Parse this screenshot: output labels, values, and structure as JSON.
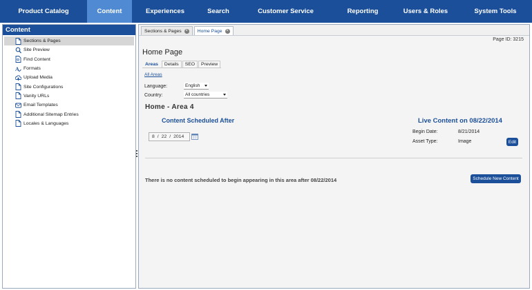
{
  "topnav": {
    "items": [
      {
        "label": "Product Catalog",
        "name": "nav-product-catalog"
      },
      {
        "label": "Content",
        "name": "nav-content"
      },
      {
        "label": "Experiences",
        "name": "nav-experiences"
      },
      {
        "label": "Search",
        "name": "nav-search"
      },
      {
        "label": "Customer Service",
        "name": "nav-customer-service"
      },
      {
        "label": "Reporting",
        "name": "nav-reporting"
      },
      {
        "label": "Users & Roles",
        "name": "nav-users-roles"
      },
      {
        "label": "System Tools",
        "name": "nav-system-tools"
      }
    ],
    "active_index": 1
  },
  "sidebar": {
    "title": "Content",
    "items": [
      {
        "label": "Sections & Pages",
        "icon": "page-icon"
      },
      {
        "label": "Site Preview",
        "icon": "magnifier-icon"
      },
      {
        "label": "Find Content",
        "icon": "page-search-icon"
      },
      {
        "label": "Formats",
        "icon": "format-icon"
      },
      {
        "label": "Upload Media",
        "icon": "upload-icon"
      },
      {
        "label": "Site Configurations",
        "icon": "page-icon"
      },
      {
        "label": "Vanity URLs",
        "icon": "page-icon"
      },
      {
        "label": "Email Templates",
        "icon": "email-icon"
      },
      {
        "label": "Additional Sitemap Entries",
        "icon": "page-icon"
      },
      {
        "label": "Locales & Languages",
        "icon": "page-icon"
      }
    ],
    "active_index": 0
  },
  "tabs": [
    {
      "label": "Sections & Pages"
    },
    {
      "label": "Home Page"
    }
  ],
  "page": {
    "page_id": "Page ID: 3215",
    "title": "Home Page",
    "subtabs": [
      "Areas",
      "Details",
      "SEO",
      "Preview"
    ],
    "all_areas_link": "All Areas",
    "language_label": "Language:",
    "language_value": "English",
    "country_label": "Country:",
    "country_value": "All countries",
    "area_title": "Home - Area 4",
    "scheduled_title": "Content Scheduled After",
    "date": {
      "month": "8",
      "day": "22",
      "year": "2014",
      "sep": "/"
    },
    "live_title": "Live Content on 08/22/2014",
    "begin_date_label": "Begin Date:",
    "begin_date_value": "8/21/2014",
    "asset_type_label": "Asset Type:",
    "asset_type_value": "Image",
    "edit_label": "Edit",
    "no_content_text": "There is no content scheduled to begin appearing in this area after 08/22/2014",
    "schedule_button": "Schedule New Content"
  },
  "colors": {
    "brand": "#1b4f99",
    "active_nav": "#4f8ad2"
  }
}
